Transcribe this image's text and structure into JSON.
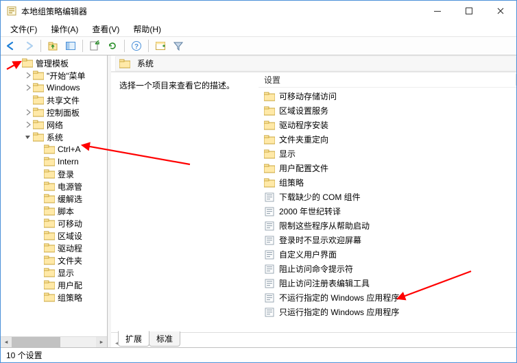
{
  "titlebar": {
    "title": "本地组策略编辑器"
  },
  "menu": {
    "file": "文件(F)",
    "action": "操作(A)",
    "view": "查看(V)",
    "help": "帮助(H)"
  },
  "tree": {
    "root": "管理模板",
    "items": [
      {
        "label": "\"开始\"菜单",
        "hasChildren": true
      },
      {
        "label": "Windows",
        "hasChildren": true
      },
      {
        "label": "共享文件",
        "hasChildren": false
      },
      {
        "label": "控制面板",
        "hasChildren": true
      },
      {
        "label": "网络",
        "hasChildren": true
      }
    ],
    "system": "系统",
    "systemChildren": [
      "Ctrl+A",
      "Intern",
      "登录",
      "电源管",
      "缓解选",
      "脚本",
      "可移动",
      "区域设",
      "驱动程",
      "文件夹",
      "显示",
      "用户配",
      "组策略"
    ]
  },
  "path": {
    "label": "系统"
  },
  "desc": {
    "placeholder": "选择一个项目来查看它的描述。"
  },
  "list": {
    "header": "设置",
    "folders": [
      "可移动存储访问",
      "区域设置服务",
      "驱动程序安装",
      "文件夹重定向",
      "显示",
      "用户配置文件",
      "组策略"
    ],
    "settings": [
      "下载缺少的 COM 组件",
      "2000 年世纪转译",
      "限制这些程序从帮助启动",
      "登录时不显示欢迎屏幕",
      "自定义用户界面",
      "阻止访问命令提示符",
      "阻止访问注册表编辑工具",
      "不运行指定的 Windows 应用程序",
      "只运行指定的 Windows 应用程序"
    ]
  },
  "tabs": {
    "extended": "扩展",
    "standard": "标准"
  },
  "status": {
    "text": "10 个设置"
  }
}
